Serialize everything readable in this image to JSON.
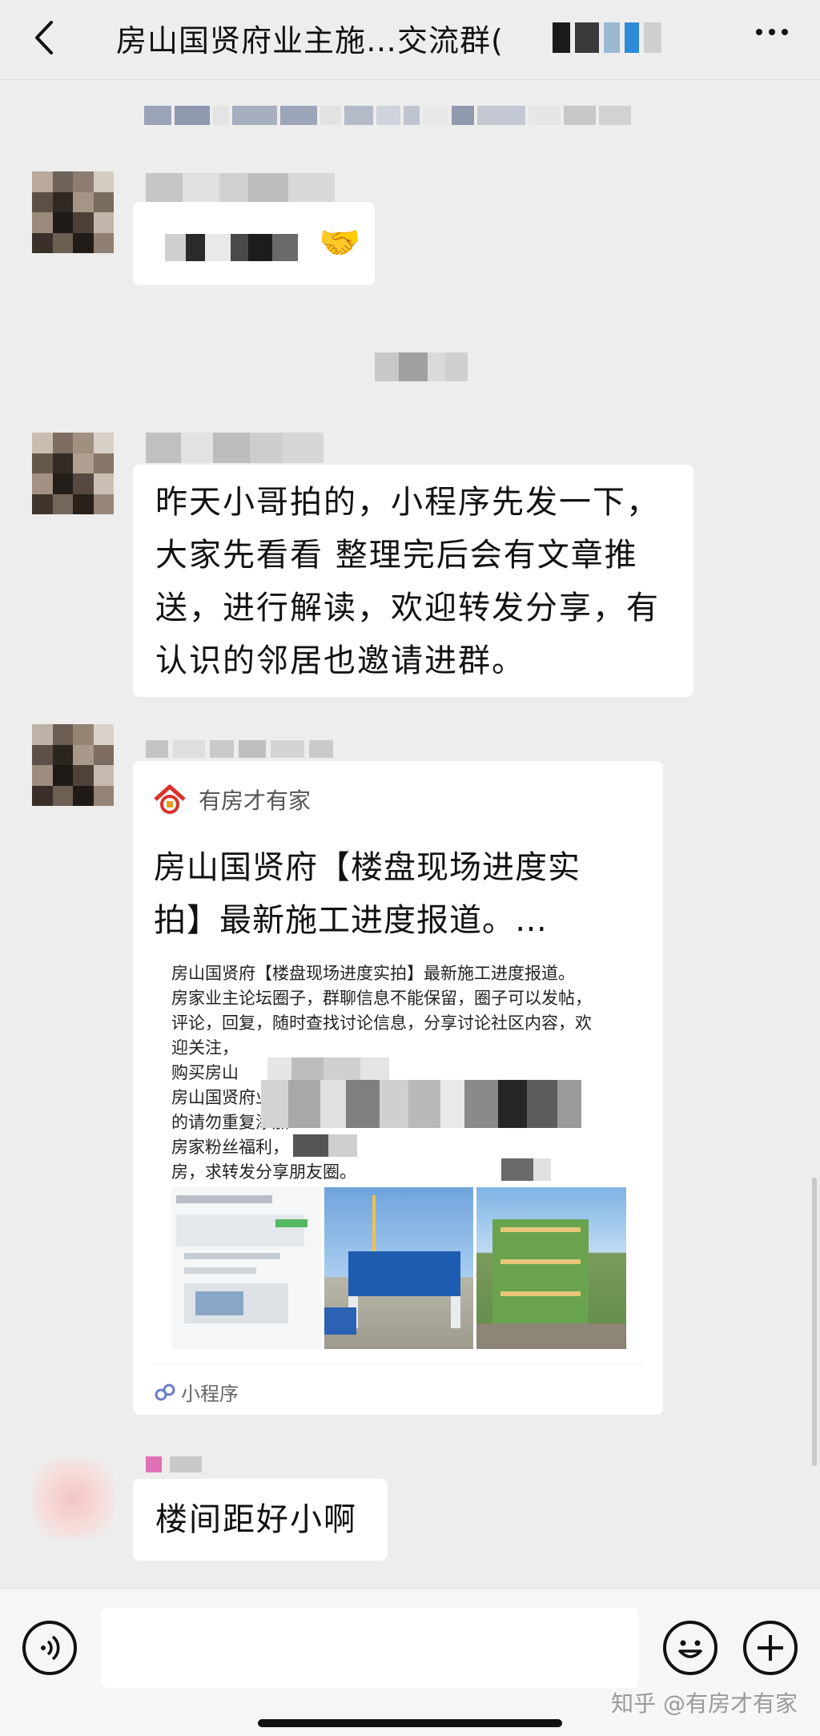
{
  "header": {
    "title": "房山国贤府业主施…交流群(",
    "back_icon": "chevron-left-icon",
    "more_icon": "more-dots-icon"
  },
  "messages": [
    {
      "type": "text",
      "sender_name": "",
      "text": "",
      "emoji": "🤝"
    },
    {
      "type": "text",
      "sender_name": "",
      "lines": [
        "昨天小哥拍的，小程序先发一下，",
        "大家先看看 整理完后会有文章推",
        "送，进行解读，欢迎转发分享，有",
        "认识的邻居也邀请进群。"
      ]
    },
    {
      "type": "mini-program-card",
      "source": "有房才有家",
      "title_lines": [
        "房山国贤府【楼盘现场进度实",
        "拍】最新施工进度报道。…"
      ],
      "body_lines": [
        "房山国贤府【楼盘现场进度实拍】最新施工进度报道。",
        "房家业主论坛圈子，群聊信息不能保留，圈子可以发帖，",
        "评论，回复，随时查找讨论信息，分享讨论社区内容，欢",
        "迎关注，",
        "购买房山",
        "房山国贤府业",
        "的请勿重复添加",
        "房家粉丝福利，",
        "房，求转发分享朋友圈。"
      ],
      "footer_label": "小程序",
      "footer_icon": "mini-program-icon"
    },
    {
      "type": "text",
      "sender_name": "",
      "text": "楼间距好小啊"
    }
  ],
  "input": {
    "voice_icon": "voice-icon",
    "emoji_icon": "emoji-icon",
    "plus_icon": "plus-icon",
    "placeholder": ""
  },
  "watermark": "知乎 @有房才有家"
}
